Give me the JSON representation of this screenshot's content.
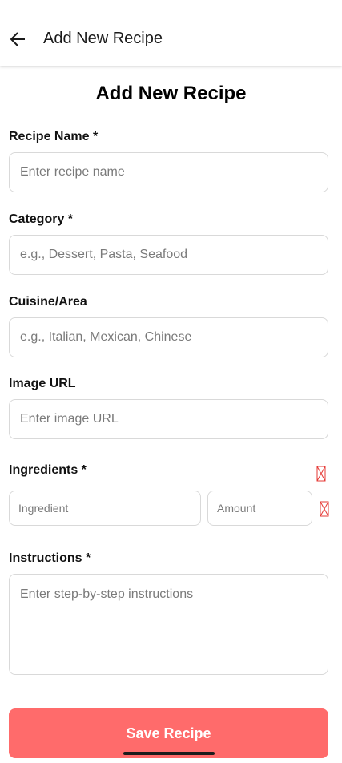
{
  "app_bar": {
    "back_icon": "arrow-left-icon",
    "title": "Add New Recipe"
  },
  "form": {
    "heading": "Add New Recipe",
    "recipe_name": {
      "label": "Recipe Name *",
      "placeholder": "Enter recipe name",
      "value": ""
    },
    "category": {
      "label": "Category *",
      "placeholder": "e.g., Dessert, Pasta, Seafood",
      "value": ""
    },
    "cuisine": {
      "label": "Cuisine/Area",
      "placeholder": "e.g., Italian, Mexican, Chinese",
      "value": ""
    },
    "image_url": {
      "label": "Image URL",
      "placeholder": "Enter image URL",
      "value": ""
    },
    "ingredients": {
      "label": "Ingredients *",
      "header_icon": "delete-icon",
      "rows": [
        {
          "ingredient_placeholder": "Ingredient",
          "amount_placeholder": "Amount",
          "remove_icon": "delete-icon"
        }
      ]
    },
    "instructions": {
      "label": "Instructions *",
      "placeholder": "Enter step-by-step instructions",
      "value": ""
    },
    "save_label": "Save Recipe"
  },
  "colors": {
    "accent": "#ff6b6b",
    "icon_red": "#e53935",
    "border": "#d9d9d9",
    "placeholder": "#7a7a7a"
  }
}
